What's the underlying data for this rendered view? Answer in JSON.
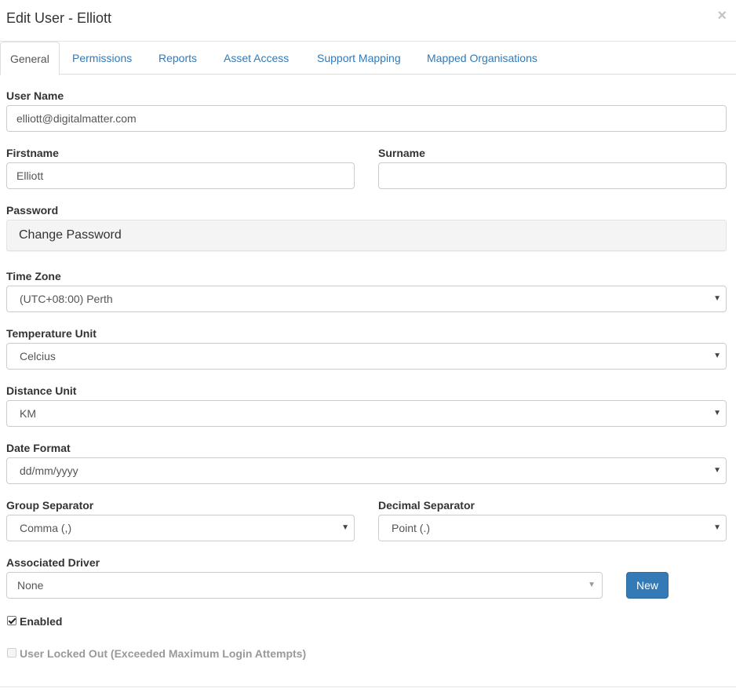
{
  "header": {
    "title": "Edit User - Elliott",
    "close": "×"
  },
  "tabs": [
    {
      "label": "General",
      "active": true
    },
    {
      "label": "Permissions"
    },
    {
      "label": "Reports"
    },
    {
      "label": "Asset Access"
    },
    {
      "label": "Support Mapping"
    },
    {
      "label": "Mapped Organisations"
    }
  ],
  "form": {
    "username": {
      "label": "User Name",
      "value": "elliott@digitalmatter.com"
    },
    "firstname": {
      "label": "Firstname",
      "value": "Elliott"
    },
    "surname": {
      "label": "Surname",
      "value": ""
    },
    "password": {
      "label": "Password",
      "button": "Change Password"
    },
    "timezone": {
      "label": "Time Zone",
      "value": "(UTC+08:00) Perth"
    },
    "temperature": {
      "label": "Temperature Unit",
      "value": "Celcius"
    },
    "distance": {
      "label": "Distance Unit",
      "value": "KM"
    },
    "date_format": {
      "label": "Date Format",
      "value": "dd/mm/yyyy"
    },
    "group_sep": {
      "label": "Group Separator",
      "value": "Comma (,)"
    },
    "decimal_sep": {
      "label": "Decimal Separator",
      "value": "Point (.)"
    },
    "driver": {
      "label": "Associated Driver",
      "value": "None",
      "new_button": "New"
    },
    "enabled": {
      "label": "Enabled",
      "checked": true
    },
    "locked": {
      "label": "User Locked Out (Exceeded Maximum Login Attempts)",
      "checked": false
    }
  },
  "icons": {
    "caret": "▼"
  },
  "colors": {
    "link": "#337ab7",
    "primary_button": "#337ab7",
    "disabled_text": "#999999"
  }
}
